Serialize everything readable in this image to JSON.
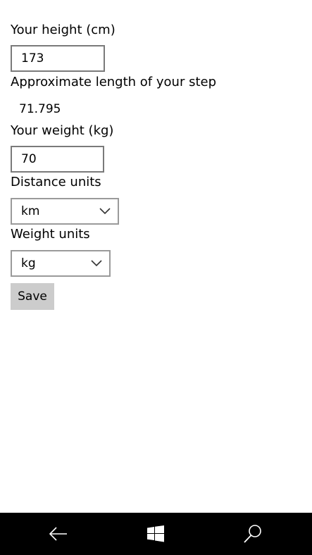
{
  "form": {
    "height_label": "Your height (cm)",
    "height_value": "173",
    "step_label": "Approximate length of your step",
    "step_value": "71.795",
    "weight_label": "Your weight (kg)",
    "weight_value": "70",
    "distance_units_label": "Distance units",
    "distance_units_selected": "km",
    "weight_units_label": "Weight units",
    "weight_units_selected": "kg",
    "save_label": "Save"
  },
  "navbar": {
    "icons": [
      "back-arrow-icon",
      "windows-logo-icon",
      "search-icon"
    ],
    "background": "#000000",
    "icon_color": "#ffffff"
  },
  "colors": {
    "background": "#ffffff",
    "button_bg": "#cccccc",
    "field_border": "#7a7a7a"
  }
}
